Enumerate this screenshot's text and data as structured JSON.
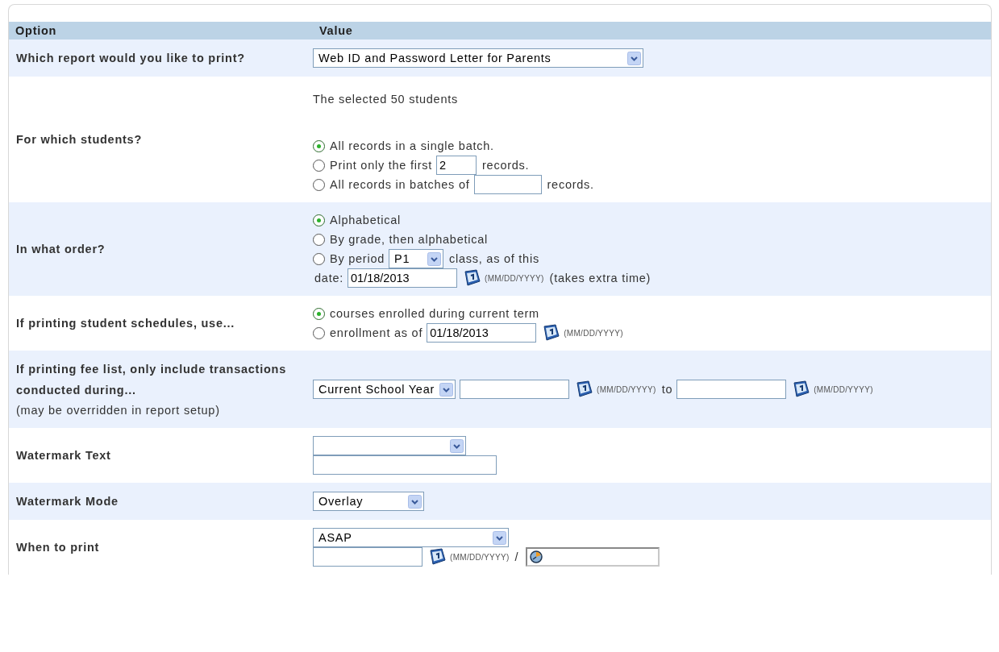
{
  "table": {
    "columns": [
      "Option",
      "Value"
    ],
    "rows": [
      {
        "label": "Which report would you like to print?",
        "lines": [
          {
            "items": [
              {
                "kind": "select",
                "value": "Web ID and Password Letter for Parents"
              }
            ]
          }
        ]
      },
      {
        "label": "For which students?",
        "note": "The selected 50 students",
        "lines": [
          {
            "items": [
              {
                "kind": "radio",
                "selected": true,
                "label": "All records in a single batch."
              }
            ]
          },
          {
            "items": [
              {
                "kind": "radio",
                "selected": false,
                "label": "Print only the first"
              },
              {
                "kind": "input",
                "value": "2"
              },
              {
                "kind": "text",
                "text": "records."
              }
            ]
          },
          {
            "items": [
              {
                "kind": "radio",
                "selected": false,
                "label": "All records in batches of"
              },
              {
                "kind": "input"
              },
              {
                "kind": "text",
                "text": "records."
              }
            ]
          }
        ]
      },
      {
        "label": "In what order?",
        "lines": [
          {
            "items": [
              {
                "kind": "radio",
                "selected": true,
                "label": "Alphabetical"
              }
            ]
          },
          {
            "items": [
              {
                "kind": "radio",
                "selected": false,
                "label": "By grade, then alphabetical"
              }
            ]
          },
          {
            "items": [
              {
                "kind": "radio",
                "selected": false,
                "label": "By period"
              },
              {
                "kind": "select",
                "value": "P1"
              },
              {
                "kind": "text",
                "text": "class, as of this"
              }
            ]
          },
          {
            "items": [
              {
                "kind": "text",
                "text": "date:"
              },
              {
                "kind": "input",
                "value": "01/18/2013"
              },
              {
                "kind": "calendar"
              },
              {
                "kind": "hint",
                "text": "(MM/DD/YYYY)"
              },
              {
                "kind": "text",
                "text": "(takes extra time)"
              }
            ]
          }
        ]
      },
      {
        "label": "If printing student schedules, use...",
        "lines": [
          {
            "items": [
              {
                "kind": "radio",
                "selected": true,
                "label": "courses enrolled during current term"
              }
            ]
          },
          {
            "items": [
              {
                "kind": "radio",
                "selected": false,
                "label": "enrollment as of"
              },
              {
                "kind": "input",
                "value": "01/18/2013"
              },
              {
                "kind": "calendar"
              },
              {
                "kind": "hint",
                "text": "(MM/DD/YYYY)"
              }
            ]
          }
        ]
      },
      {
        "label": "If printing fee list, only include transactions conducted during...",
        "label_note": "(may be overridden in report setup)",
        "lines": [
          {
            "items": [
              {
                "kind": "select",
                "value": "Current School Year"
              },
              {
                "kind": "input"
              },
              {
                "kind": "calendar"
              },
              {
                "kind": "hint",
                "text": "(MM/DD/YYYY)"
              },
              {
                "kind": "text",
                "text": "to"
              },
              {
                "kind": "input"
              },
              {
                "kind": "calendar"
              },
              {
                "kind": "hint",
                "text": "(MM/DD/YYYY)"
              }
            ]
          }
        ]
      },
      {
        "label": "Watermark Text",
        "lines": [
          {
            "items": [
              {
                "kind": "select"
              }
            ]
          },
          {
            "items": [
              {
                "kind": "input"
              }
            ]
          }
        ]
      },
      {
        "label": "Watermark Mode",
        "lines": [
          {
            "items": [
              {
                "kind": "select",
                "value": "Overlay"
              }
            ]
          }
        ]
      },
      {
        "label": "When to print",
        "lines": [
          {
            "items": [
              {
                "kind": "select",
                "value": "ASAP"
              }
            ]
          },
          {
            "items": [
              {
                "kind": "input"
              },
              {
                "kind": "calendar"
              },
              {
                "kind": "hint",
                "text": "(MM/DD/YYYY)"
              },
              {
                "kind": "text",
                "text": "/"
              },
              {
                "kind": "clock-input"
              }
            ]
          }
        ]
      }
    ]
  }
}
